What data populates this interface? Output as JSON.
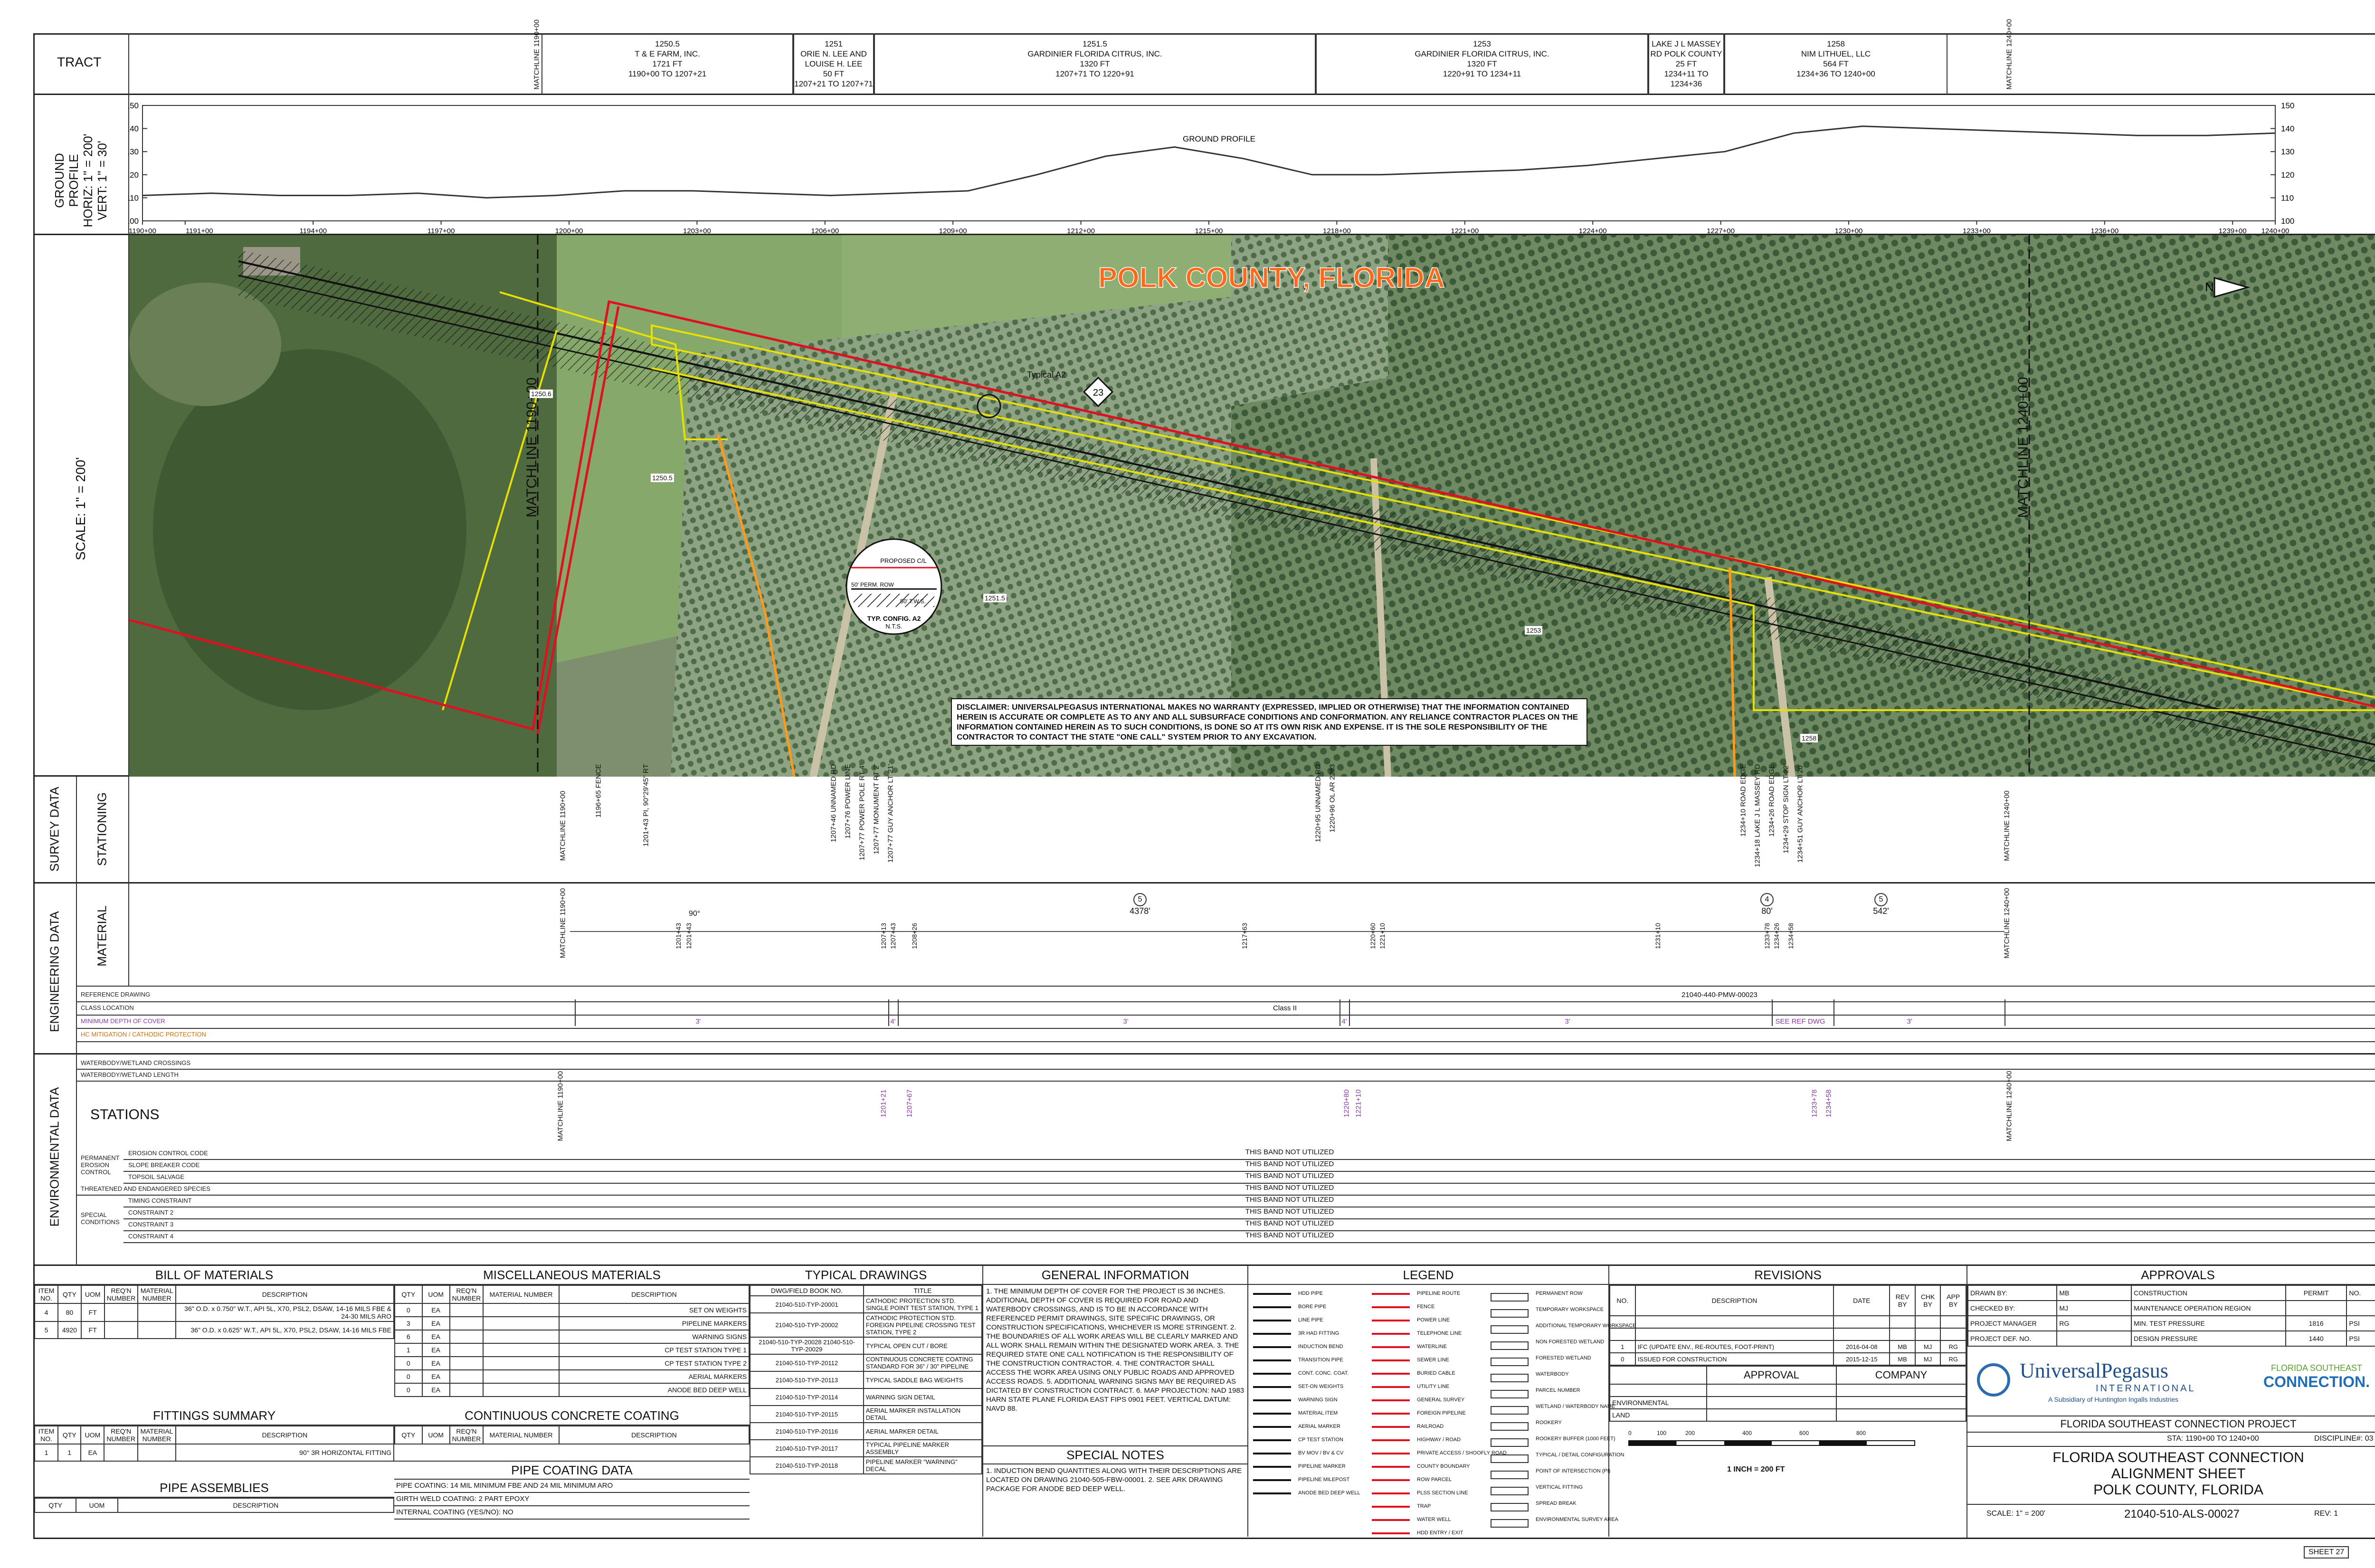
{
  "tract": {
    "label": "TRACT",
    "matchline_left": "MATCHLINE 1190+00",
    "matchline_right": "MATCHLINE 1240+00",
    "cells": [
      {
        "id": "1250.5",
        "owner": "T & E FARM, INC.",
        "length": "1721 FT",
        "range": "1190+00 TO 1207+21"
      },
      {
        "id": "1251",
        "owner": "ORIE N. LEE AND LOUISE H. LEE",
        "length": "50 FT",
        "range": "1207+21 TO 1207+71"
      },
      {
        "id": "1251.5",
        "owner": "GARDINIER FLORIDA CITRUS, INC.",
        "length": "1320 FT",
        "range": "1207+71 TO 1220+91"
      },
      {
        "id": "1253",
        "owner": "GARDINIER FLORIDA CITRUS, INC.",
        "length": "1320 FT",
        "range": "1220+91 TO 1234+11"
      },
      {
        "id": "",
        "owner": "LAKE J L MASSEY RD POLK COUNTY",
        "length": "25 FT",
        "range": "1234+11 TO 1234+36"
      },
      {
        "id": "1258",
        "owner": "NIM LITHUEL, LLC",
        "length": "564 FT",
        "range": "1234+36 TO 1240+00"
      }
    ]
  },
  "profile": {
    "side_label": [
      "GROUND",
      "PROFILE",
      "HORIZ: 1\" = 200'",
      "VERT: 1\" = 30'"
    ],
    "curve_label": "GROUND PROFILE",
    "y_ticks": [
      "150",
      "140",
      "130",
      "120",
      "110",
      "100"
    ],
    "x_ticks": [
      "1190+00",
      "1191+00",
      "1194+00",
      "1197+00",
      "1200+00",
      "1203+00",
      "1206+00",
      "1209+00",
      "1212+00",
      "1215+00",
      "1218+00",
      "1221+00",
      "1224+00",
      "1227+00",
      "1230+00",
      "1233+00",
      "1236+00",
      "1239+00",
      "1240+00"
    ],
    "elevations": [
      111,
      112,
      111,
      111,
      112,
      110,
      111,
      113,
      113,
      112,
      111,
      112,
      113,
      120,
      128,
      132,
      127,
      120,
      120,
      121,
      122,
      124,
      127,
      130,
      138,
      141,
      140,
      139,
      138,
      137,
      137,
      138
    ]
  },
  "map": {
    "scale_label": "SCALE: 1\" = 200'",
    "county_title": "POLK COUNTY, FLORIDA",
    "matchline_left": "MATCHLINE 1190+00",
    "matchline_right": "MATCHLINE 1240+00",
    "marker_23": "23",
    "typical_label": "Typical A2",
    "parcels": [
      "1250.5",
      "1250.6",
      "1250.5",
      "1251",
      "1251.5",
      "1253",
      "1258"
    ],
    "road_labels": [
      "UNNAMED RD",
      "UNNAMED RD",
      "LAKE J L MASSEY RD"
    ],
    "inset": {
      "proposed": "PROPOSED C/L",
      "perm_row": "50' PERM. ROW",
      "tws": "50' T.W.S.",
      "caption": "TYP. CONFIG. A2",
      "nts": "N.T.S."
    },
    "disclaimer": "DISCLAIMER: UNIVERSALPEGASUS INTERNATIONAL MAKES NO WARRANTY (EXPRESSED, IMPLIED OR OTHERWISE) THAT THE INFORMATION CONTAINED HEREIN IS ACCURATE OR COMPLETE AS TO ANY AND ALL SUBSURFACE CONDITIONS AND CONFORMATION. ANY RELIANCE CONTRACTOR PLACES ON THE INFORMATION CONTAINED HEREIN AS TO SUCH CONDITIONS, IS DONE SO AT ITS OWN RISK AND EXPENSE. IT IS THE SOLE RESPONSIBILITY OF THE CONTRACTOR TO CONTACT THE STATE \"ONE CALL\" SYSTEM PRIOR TO ANY EXCAVATION.",
    "north": "N"
  },
  "survey": {
    "group_label": "SURVEY DATA",
    "row_label": "STATIONING",
    "entries": [
      "1196+65 FENCE",
      "1201+43 PI, 90°29'45\" RT",
      "1207+46 UNNAMED RD",
      "1207+76 POWER LINE",
      "1207+77 POWER POLE RT 4'",
      "1207+77 MONUMENT RT 2'",
      "1207+77 GUY ANCHOR LT 21'",
      "1220+95 UNNAMED RD",
      "1220+96 OL AR 2283",
      "1234+10 ROAD EDGE",
      "1234+18 LAKE J L MASSEY RD",
      "1234+26 ROAD EDGE",
      "1234+29 STOP SIGN LT 22'",
      "1234+51 GUY ANCHOR LT 20'"
    ]
  },
  "engineering": {
    "group_label": "ENGINEERING DATA",
    "row_label": "MATERIAL",
    "callouts": [
      {
        "num": "5",
        "len": "4378'"
      },
      {
        "num": "4",
        "len": "80'"
      },
      {
        "num": "5",
        "len": "542'"
      }
    ],
    "bend": "90°",
    "stations": [
      "1201+43",
      "1201+43",
      "1207+13",
      "1207+43",
      "1208+26",
      "1217+63",
      "1220+60",
      "1221+10",
      "1231+10",
      "1233+78",
      "1234+26",
      "1234+58"
    ],
    "rows": [
      "REFERENCE DRAWING",
      "CLASS LOCATION",
      "MINIMUM DEPTH OF COVER",
      "HC MITIGATION / CATHODIC PROTECTION"
    ],
    "reference_drawing": "21040-440-PMW-00023",
    "class_location": "Class II",
    "cover_values": [
      "3'",
      "4'",
      "3'",
      "4'",
      "3'",
      "SEE REF DWG",
      "3'"
    ]
  },
  "environmental": {
    "group_label": "ENVIRONMENTAL DATA",
    "stations_label": "STATIONS",
    "rows": [
      "WATERBODY/WETLAND CROSSINGS",
      "WATERBODY/WETLAND LENGTH",
      "EROSION CONTROL CODE",
      "SLOPE BREAKER CODE",
      "TOPSOIL SALVAGE",
      "THREATENED AND ENDANGERED SPECIES",
      "TIMING CONSTRAINT",
      "CONSTRAINT 2",
      "CONSTRAINT 3",
      "CONSTRAINT 4"
    ],
    "sub_groups": [
      "PERMANENT EROSION CONTROL",
      "SPECIAL CONDITIONS"
    ],
    "stations": [
      "1201+21",
      "1207+67",
      "1220+80",
      "1221+10",
      "1233+78",
      "1234+58"
    ],
    "not_utilized": "THIS BAND NOT UTILIZED",
    "matchline_left": "MATCHLINE 1190+00",
    "matchline_right": "MATCHLINE 1240+00"
  },
  "bom": {
    "title": "BILL OF MATERIALS",
    "headers": [
      "ITEM NO.",
      "QTY",
      "UOM",
      "REQ'N NUMBER",
      "MATERIAL NUMBER",
      "DESCRIPTION"
    ],
    "rows": [
      [
        "4",
        "80",
        "FT",
        "",
        "",
        "36\" O.D. x 0.750\" W.T., API 5L, X70, PSL2, DSAW, 14-16 MILS FBE & 24-30 MILS ARO"
      ],
      [
        "5",
        "4920",
        "FT",
        "",
        "",
        "36\" O.D. x 0.625\" W.T., API 5L, X70, PSL2, DSAW, 14-16 MILS FBE"
      ]
    ]
  },
  "fittings": {
    "title": "FITTINGS SUMMARY",
    "headers": [
      "ITEM NO.",
      "QTY",
      "UOM",
      "REQ'N NUMBER",
      "MATERIAL NUMBER",
      "DESCRIPTION"
    ],
    "rows": [
      [
        "1",
        "1",
        "EA",
        "",
        "",
        "90° 3R HORIZONTAL FITTING"
      ]
    ]
  },
  "pipe_assemblies": {
    "title": "PIPE ASSEMBLIES",
    "headers": [
      "QTY",
      "UOM",
      "DESCRIPTION"
    ]
  },
  "misc": {
    "title": "MISCELLANEOUS MATERIALS",
    "headers": [
      "QTY",
      "UOM",
      "REQ'N NUMBER",
      "MATERIAL NUMBER",
      "DESCRIPTION"
    ],
    "rows": [
      [
        "0",
        "EA",
        "",
        "",
        "SET ON WEIGHTS"
      ],
      [
        "3",
        "EA",
        "",
        "",
        "PIPELINE MARKERS"
      ],
      [
        "6",
        "EA",
        "",
        "",
        "WARNING SIGNS"
      ],
      [
        "1",
        "EA",
        "",
        "",
        "CP TEST STATION TYPE 1"
      ],
      [
        "0",
        "EA",
        "",
        "",
        "CP TEST STATION TYPE 2"
      ],
      [
        "0",
        "EA",
        "",
        "",
        "AERIAL MARKERS"
      ],
      [
        "0",
        "EA",
        "",
        "",
        "ANODE BED DEEP WELL"
      ]
    ]
  },
  "concrete": {
    "title": "CONTINUOUS CONCRETE COATING",
    "headers": [
      "QTY",
      "UOM",
      "REQ'N NUMBER",
      "MATERIAL NUMBER",
      "DESCRIPTION"
    ]
  },
  "pipe_coating": {
    "title": "PIPE COATING DATA",
    "rows": [
      "PIPE COATING: 14 MIL MINIMUM FBE AND 24 MIL MINIMUM ARO",
      "GIRTH WELD COATING: 2 PART EPOXY",
      "INTERNAL COATING (YES/NO): NO"
    ]
  },
  "typical": {
    "title": "TYPICAL DRAWINGS",
    "headers": [
      "DWG/FIELD BOOK NO.",
      "TITLE"
    ],
    "rows": [
      [
        "21040-510-TYP-20001",
        "CATHODIC PROTECTION STD. SINGLE POINT TEST STATION, TYPE 1"
      ],
      [
        "21040-510-TYP-20002",
        "CATHODIC PROTECTION STD. FOREIGN PIPELINE CROSSING TEST STATION, TYPE 2"
      ],
      [
        "21040-510-TYP-20028 21040-510-TYP-20029",
        "TYPICAL OPEN CUT / BORE"
      ],
      [
        "21040-510-TYP-20112",
        "CONTINUOUS CONCRETE COATING STANDARD FOR 36\" / 30\" PIPELINE"
      ],
      [
        "21040-510-TYP-20113",
        "TYPICAL SADDLE BAG WEIGHTS"
      ],
      [
        "21040-510-TYP-20114",
        "WARNING SIGN DETAIL"
      ],
      [
        "21040-510-TYP-20115",
        "AERIAL MARKER INSTALLATION DETAIL"
      ],
      [
        "21040-510-TYP-20116",
        "AERIAL MARKER DETAIL"
      ],
      [
        "21040-510-TYP-20117",
        "TYPICAL PIPELINE MARKER ASSEMBLY"
      ],
      [
        "21040-510-TYP-20118",
        "PIPELINE MARKER \"WARNING\" DECAL"
      ]
    ]
  },
  "general": {
    "title": "GENERAL INFORMATION",
    "text": "1. THE MINIMUM DEPTH OF COVER FOR THE PROJECT IS 36 INCHES. ADDITIONAL DEPTH OF COVER IS REQUIRED FOR ROAD AND WATERBODY CROSSINGS, AND IS TO BE IN ACCORDANCE WITH REFERENCED PERMIT DRAWINGS, SITE SPECIFIC DRAWINGS, OR CONSTRUCTION SPECIFICATIONS, WHICHEVER IS MORE STRINGENT. 2. THE BOUNDARIES OF ALL WORK AREAS WILL BE CLEARLY MARKED AND ALL WORK SHALL REMAIN WITHIN THE DESIGNATED WORK AREA. 3. THE REQUIRED STATE ONE CALL NOTIFICATION IS THE RESPONSIBILITY OF THE CONSTRUCTION CONTRACTOR. 4. THE CONTRACTOR SHALL ACCESS THE WORK AREA USING ONLY PUBLIC ROADS AND APPROVED ACCESS ROADS. 5. ADDITIONAL WARNING SIGNS MAY BE REQUIRED AS DICTATED BY CONSTRUCTION CONTRACT. 6. MAP PROJECTION: NAD 1983 HARN STATE PLANE FLORIDA EAST FIPS 0901 FEET. VERTICAL DATUM: NAVD 88.",
    "special_title": "SPECIAL NOTES",
    "special_text": "1. INDUCTION BEND QUANTITIES ALONG WITH THEIR DESCRIPTIONS ARE LOCATED ON DRAWING 21040-505-FBW-00001. 2. SEE ARK DRAWING PACKAGE FOR ANODE BED DEEP WELL."
  },
  "legend": {
    "title": "LEGEND",
    "col1": [
      "HDD PIPE",
      "BORE PIPE",
      "LINE PIPE",
      "3R HAD FITTING",
      "INDUCTION BEND",
      "TRANSITION PIPE",
      "CONT. CONC. COAT.",
      "SET-ON WEIGHTS",
      "WARNING SIGN",
      "MATERIAL ITEM",
      "AERIAL MARKER",
      "CP TEST STATION",
      "BV MOV / BV & CV",
      "PIPELINE MARKER",
      "PIPELINE MILEPOST",
      "ANODE BED DEEP WELL"
    ],
    "col2": [
      "PIPELINE ROUTE",
      "FENCE",
      "POWER LINE",
      "TELEPHONE LINE",
      "WATERLINE",
      "SEWER LINE",
      "BURIED CABLE",
      "UTILITY LINE",
      "GENERAL SURVEY",
      "FOREIGN PIPELINE",
      "RAILROAD",
      "HIGHWAY / ROAD",
      "PRIVATE ACCESS / SHOOFLY ROAD",
      "COUNTY BOUNDARY",
      "ROW PARCEL",
      "PLSS SECTION LINE",
      "TRAP",
      "WATER WELL",
      "HDD ENTRY / EXIT"
    ],
    "col3": [
      "PERMANENT ROW",
      "TEMPORARY WORKSPACE",
      "ADDITIONAL TEMPORARY WORKSPACE",
      "NON FORESTED WETLAND",
      "FORESTED WETLAND",
      "WATERBODY",
      "PARCEL NUMBER",
      "WETLAND / WATERBODY NAME",
      "ROOKERY",
      "ROOKERY BUFFER (1000 FEET)",
      "TYPICAL / DETAIL CONFIGURATION",
      "POINT OF INTERSECTION (PI)",
      "VERTICAL FITTING",
      "SPREAD BREAK",
      "ENVIRONMENTAL SURVEY AREA"
    ]
  },
  "revisions": {
    "title": "REVISIONS",
    "headers": [
      "NO.",
      "DESCRIPTION",
      "DATE",
      "REV BY",
      "CHK BY",
      "APP BY"
    ],
    "rows": [
      [
        "1",
        "IFC (UPDATE ENV., RE-ROUTES, FOOT-PRINT)",
        "2016-04-08",
        "MB",
        "MJ",
        "RG"
      ],
      [
        "0",
        "ISSUED FOR CONSTRUCTION",
        "2015-12-15",
        "MB",
        "MJ",
        "RG"
      ]
    ],
    "approval": "APPROVAL",
    "company": "COMPANY",
    "approval_rows": [
      "ENVIRONMENTAL",
      "LAND"
    ],
    "scale_ticks": [
      "0",
      "100",
      "200",
      "400",
      "600",
      "800"
    ],
    "scale_text": "1 INCH = 200 FT"
  },
  "approvals": {
    "title": "APPROVALS",
    "left": [
      [
        "DRAWN BY:",
        "MB"
      ],
      [
        "CHECKED BY:",
        "MJ"
      ],
      [
        "PROJECT MANAGER",
        "RG"
      ],
      [
        "PROJECT DEF. NO.",
        ""
      ]
    ],
    "right": [
      [
        "CONSTRUCTION",
        "PERMIT",
        "NO."
      ],
      [
        "MAINTENANCE OPERATION REGION",
        "",
        ""
      ],
      [
        "MIN. TEST PRESSURE",
        "1816",
        "PSI"
      ],
      [
        "DESIGN PRESSURE",
        "1440",
        "PSI"
      ]
    ],
    "logo_main": "UniversalPegasus",
    "logo_sub": "INTERNATIONAL",
    "logo_tag": "A Subsidiary of Huntington Ingalls Industries",
    "logo2_top": "FLORIDA SOUTHEAST",
    "logo2_bottom": "CONNECTION.",
    "project": "FLORIDA SOUTHEAST CONNECTION PROJECT",
    "sta": "STA: 1190+00 TO 1240+00",
    "discipline": "DISCIPLINE#: 03",
    "title1": "FLORIDA SOUTHEAST CONNECTION",
    "title2": "ALIGNMENT SHEET",
    "title3": "POLK COUNTY, FLORIDA",
    "scale": "SCALE: 1\" = 200'",
    "dwg": "21040-510-ALS-00027",
    "rev": "REV: 1",
    "sheet": "SHEET 27"
  },
  "colors": {
    "route": "#e01020",
    "row": "#222222",
    "tws": "#e8e000",
    "county": "#ff6a1a"
  }
}
